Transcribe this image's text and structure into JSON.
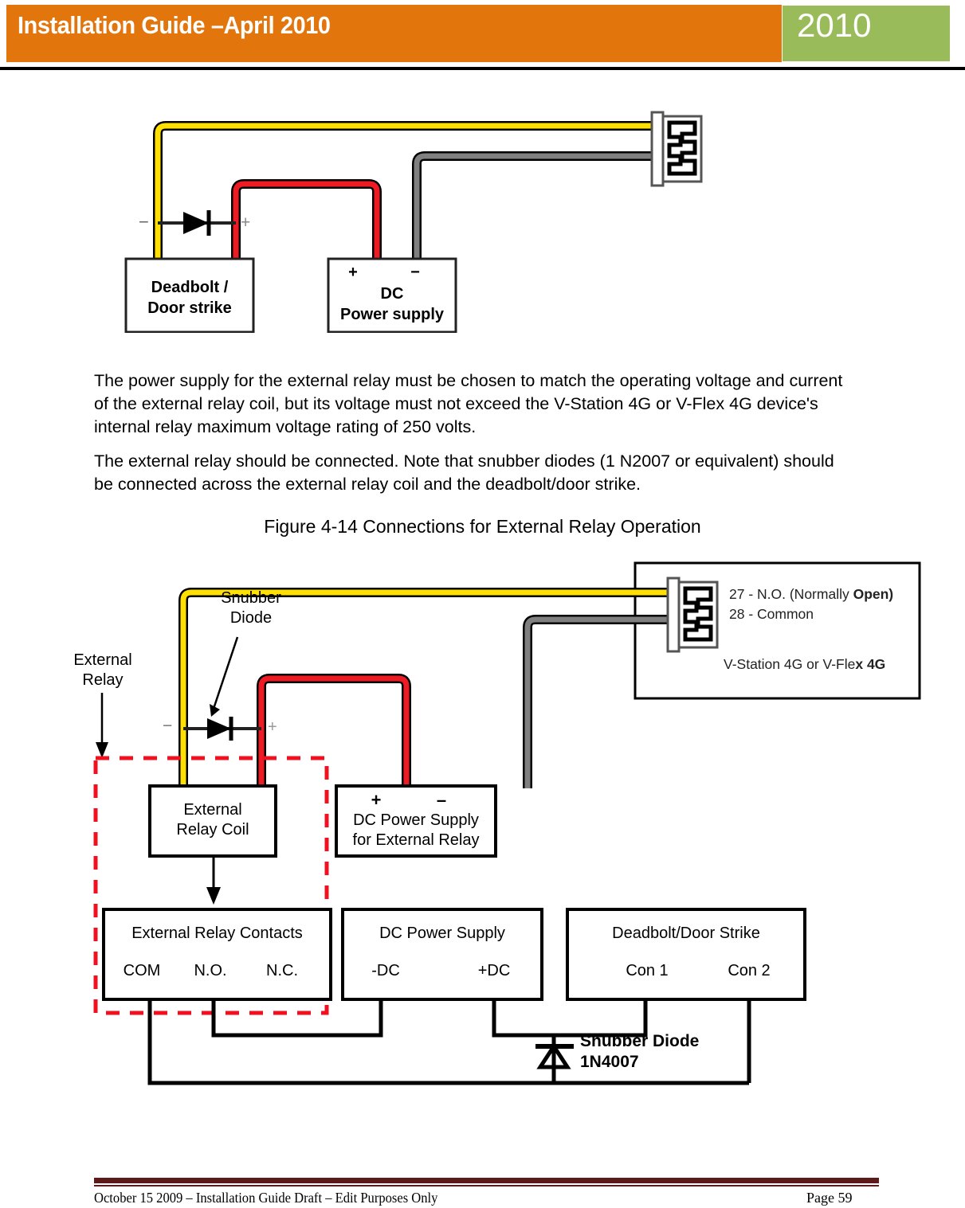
{
  "header": {
    "title": "Installation Guide –April 2010",
    "year": "2010",
    "orange_color": "#E2760D",
    "green_color": "#9ABB59"
  },
  "body": {
    "paragraph1": "The power supply for the external relay must be chosen to match the operating voltage and current of the external relay coil, but its voltage must not exceed the V-Station 4G or V-Flex 4G device's internal relay maximum voltage rating of 250 volts.",
    "paragraph2": "The external relay should be connected. Note that snubber diodes (1 N2007 or equivalent) should be connected across the external relay coil and the deadbolt/door strike.",
    "figure_caption": "Figure 4-14 Connections for External Relay Operation"
  },
  "figure_top": {
    "name": "basic-relay-wiring-diagram",
    "boxes": [
      {
        "id": "deadbolt",
        "label_line1": "Deadbolt /",
        "label_line2": "Door strike"
      },
      {
        "id": "dc-supply",
        "label_line1": "DC",
        "label_line2": "Power supply",
        "plus": "+",
        "minus": "−"
      }
    ],
    "markers": {
      "minus": "−",
      "plus": "+"
    },
    "wire_colors": {
      "yellow": "#FFE000",
      "red": "#ED1C24",
      "gray": "#808080",
      "black": "#000000"
    }
  },
  "figure_main": {
    "name": "external-relay-connection-diagram",
    "callout": {
      "line1": "27 - N.O. (Normally ",
      "line1_bold": "Open)",
      "line2": "28 - Common",
      "line3": "V-Station 4G or V-Fle",
      "line3_bold": "x 4G"
    },
    "annotations": [
      {
        "id": "snubber-diode-label",
        "line1": "Snubber",
        "line2": "Diode"
      },
      {
        "id": "external-relay-label",
        "line1": "External",
        "line2": "Relay"
      }
    ],
    "markers": {
      "minus": "−",
      "plus": "+"
    },
    "boxes": [
      {
        "id": "external-relay-coil",
        "line1": "External",
        "line2": "Relay Coil"
      },
      {
        "id": "dc-power-supply-external-relay",
        "sign_plus": "+",
        "sign_minus": "–",
        "line1": "DC Power Supply",
        "line2": "for External Relay"
      },
      {
        "id": "external-relay-contacts",
        "title": "External Relay Contacts",
        "t1": "COM",
        "t2": "N.O.",
        "t3": "N.C."
      },
      {
        "id": "dc-power-supply",
        "title": "DC Power Supply",
        "t1": "-DC",
        "t2": "+DC"
      },
      {
        "id": "deadbolt-door-strike",
        "title": "Deadbolt/Door Strike",
        "t1": "Con 1",
        "t2": "Con 2"
      }
    ],
    "bottom_diode": {
      "line1": "Snubber Diode",
      "line2": "1N4007"
    },
    "dashed_group_color": "#F01020",
    "wire_colors": {
      "yellow": "#FFE000",
      "red": "#ED1C24",
      "gray": "#808080",
      "black": "#000000"
    }
  },
  "footer": {
    "left": "October 15 2009 – Installation Guide Draft – Edit Purposes Only",
    "right": "Page 59"
  }
}
